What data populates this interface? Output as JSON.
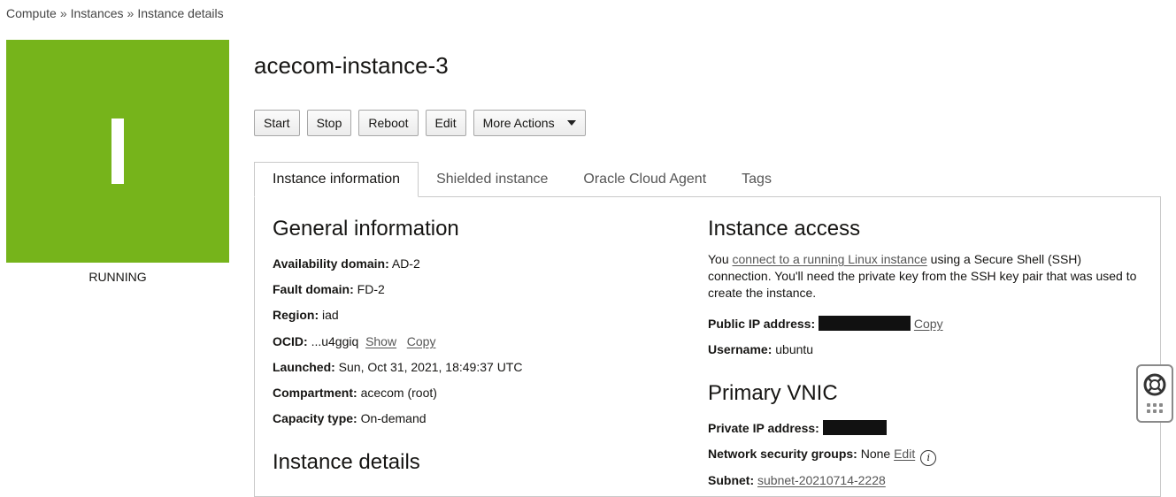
{
  "breadcrumb": {
    "items": [
      "Compute",
      "Instances",
      "Instance details"
    ],
    "separator": "»"
  },
  "status": {
    "letter": "I",
    "label": "RUNNING",
    "color": "#76b41b"
  },
  "title": "acecom-instance-3",
  "toolbar": {
    "start": "Start",
    "stop": "Stop",
    "reboot": "Reboot",
    "edit": "Edit",
    "more": "More Actions"
  },
  "tabs": [
    "Instance information",
    "Shielded instance",
    "Oracle Cloud Agent",
    "Tags"
  ],
  "general": {
    "title": "General information",
    "availability_label": "Availability domain:",
    "availability_value": "AD-2",
    "fault_label": "Fault domain:",
    "fault_value": "FD-2",
    "region_label": "Region:",
    "region_value": "iad",
    "ocid_label": "OCID:",
    "ocid_value": "...u4ggiq",
    "ocid_show": "Show",
    "ocid_copy": "Copy",
    "launched_label": "Launched:",
    "launched_value": "Sun, Oct 31, 2021, 18:49:37 UTC",
    "compartment_label": "Compartment:",
    "compartment_value": "acecom (root)",
    "capacity_label": "Capacity type:",
    "capacity_value": "On-demand"
  },
  "details": {
    "title": "Instance details"
  },
  "access": {
    "title": "Instance access",
    "text_before": "You ",
    "link": "connect to a running Linux instance",
    "text_after": " using a Secure Shell (SSH) connection. You'll need the private key from the SSH key pair that was used to create the instance.",
    "public_ip_label": "Public IP address:",
    "copy": "Copy",
    "username_label": "Username:",
    "username_value": "ubuntu"
  },
  "vnic": {
    "title": "Primary VNIC",
    "private_ip_label": "Private IP address:",
    "nsg_label": "Network security groups:",
    "nsg_value": "None",
    "nsg_edit": "Edit",
    "info": "i",
    "subnet_label": "Subnet:",
    "subnet_value": "subnet-20210714-2228"
  }
}
